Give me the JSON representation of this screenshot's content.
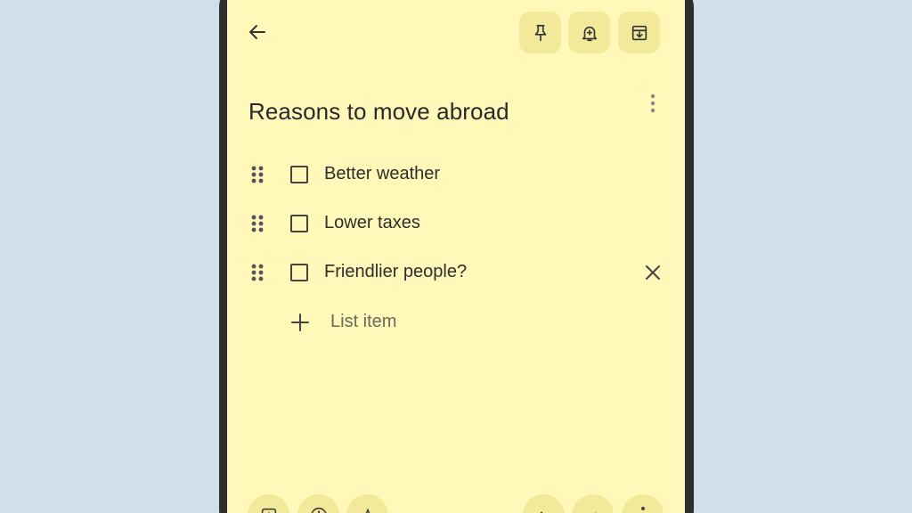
{
  "note": {
    "title": "Reasons to move abroad",
    "items": [
      {
        "text": "Better weather",
        "checked": false
      },
      {
        "text": "Lower taxes",
        "checked": false
      },
      {
        "text": "Friendlier people?",
        "checked": false
      }
    ],
    "add_placeholder": "List item"
  },
  "toolbar": {
    "back_icon": "arrow-left-icon",
    "pin_icon": "pin-icon",
    "reminder_icon": "bell-plus-icon",
    "archive_icon": "archive-icon"
  },
  "bottom_bar": {
    "icons": [
      "add-box-icon",
      "palette-icon",
      "text-format-icon",
      "undo-icon",
      "redo-icon",
      "more-vert-icon"
    ]
  },
  "colors": {
    "note_bg": "#fff8b8",
    "chip_bg": "#f3e99a",
    "page_bg": "#cfdfeb",
    "device": "#2f2f2f"
  }
}
